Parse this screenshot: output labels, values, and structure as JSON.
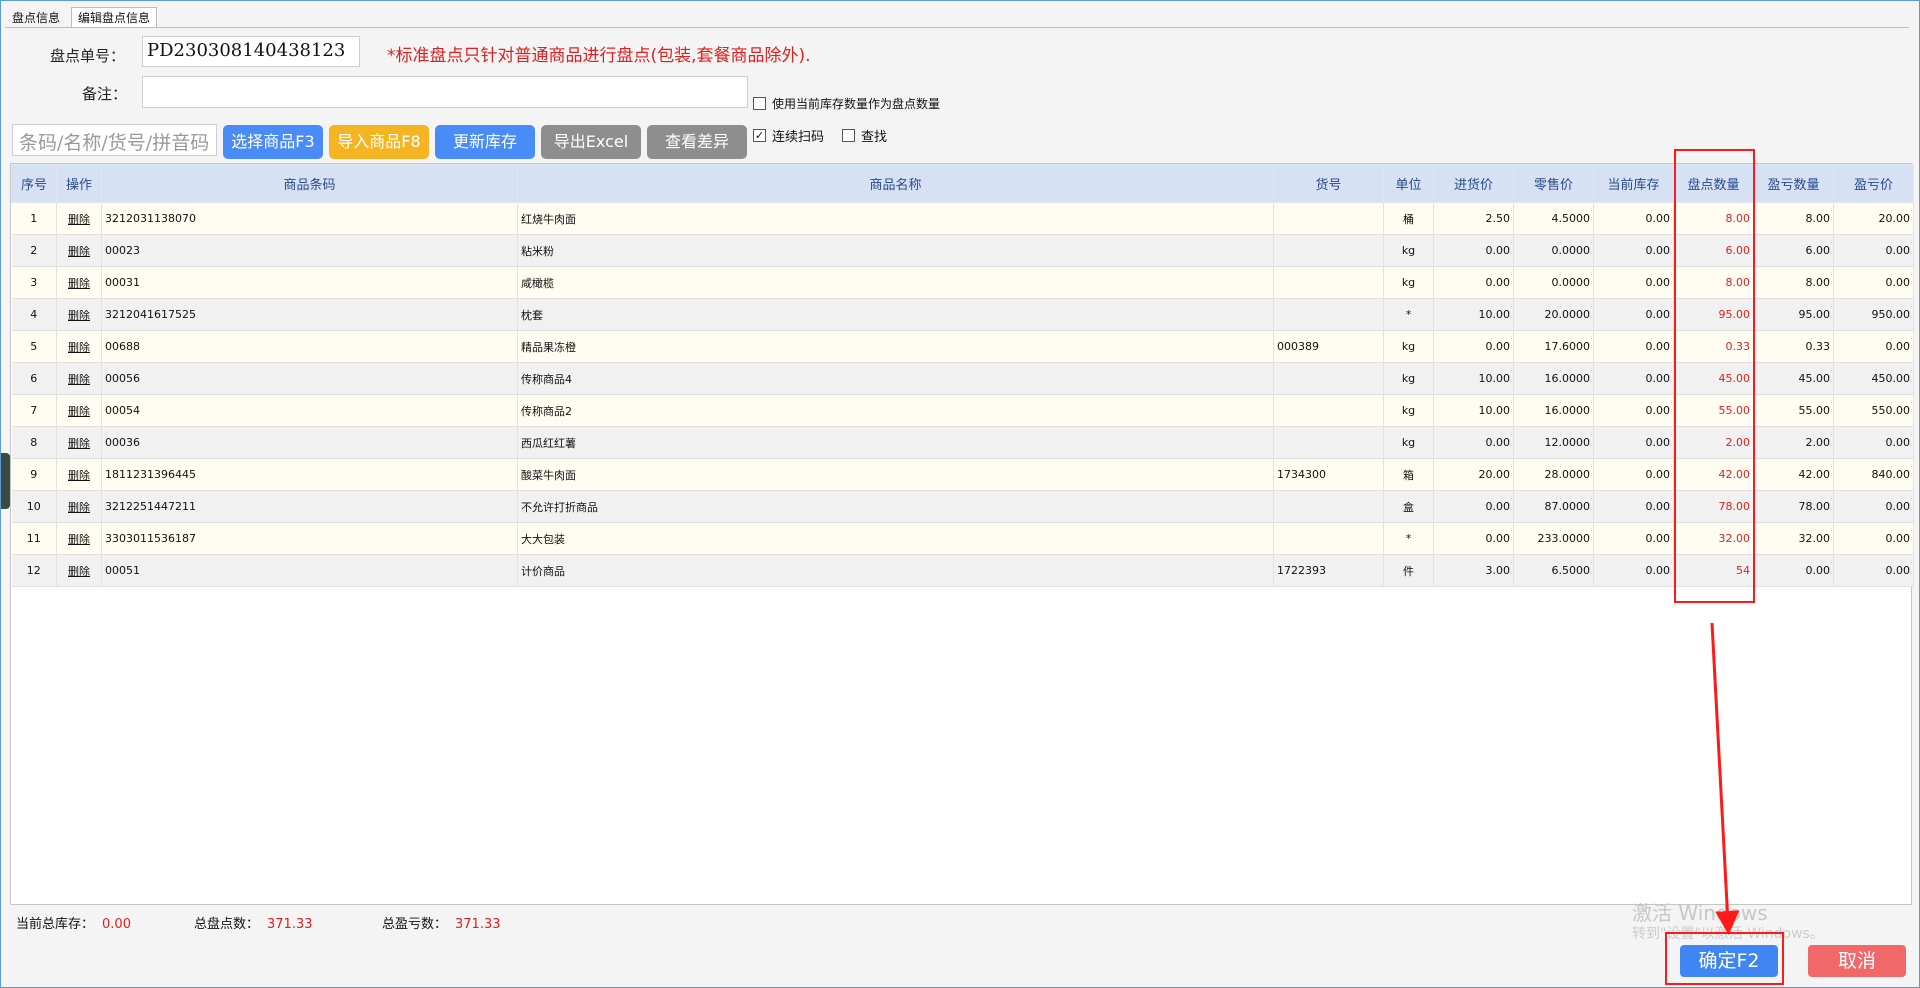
{
  "tabs": [
    "盘点信息",
    "编辑盘点信息"
  ],
  "form": {
    "order_label": "盘点单号：",
    "order_value": "PD230308140438123",
    "notice": "*标准盘点只针对普通商品进行盘点(包装,套餐商品除外).",
    "remark_label": "备注：",
    "remark_value": "",
    "use_stock_label": "使用当前库存数量作为盘点数量",
    "search_placeholder": "条码/名称/货号/拼音码",
    "continuous_scan_label": "连续扫码",
    "find_label": "查找"
  },
  "toolbar": {
    "select_goods": "选择商品F3",
    "import_goods": "导入商品F8",
    "update_stock": "更新库存",
    "export_excel": "导出Excel",
    "view_diff": "查看差异"
  },
  "columns": [
    "序号",
    "操作",
    "商品条码",
    "商品名称",
    "货号",
    "单位",
    "进货价",
    "零售价",
    "当前库存",
    "盘点数量",
    "盈亏数量",
    "盈亏价"
  ],
  "rows": [
    [
      "1",
      "删除",
      "3212031138070",
      "红烧牛肉面",
      "",
      "桶",
      "2.50",
      "4.5000",
      "0.00",
      "8.00",
      "8.00",
      "20.00"
    ],
    [
      "2",
      "删除",
      "00023",
      "粘米粉",
      "",
      "kg",
      "0.00",
      "0.0000",
      "0.00",
      "6.00",
      "6.00",
      "0.00"
    ],
    [
      "3",
      "删除",
      "00031",
      "咸橄榄",
      "",
      "kg",
      "0.00",
      "0.0000",
      "0.00",
      "8.00",
      "8.00",
      "0.00"
    ],
    [
      "4",
      "删除",
      "3212041617525",
      "枕套",
      "",
      "*",
      "10.00",
      "20.0000",
      "0.00",
      "95.00",
      "95.00",
      "950.00"
    ],
    [
      "5",
      "删除",
      "00688",
      "精品果冻橙",
      "000389",
      "kg",
      "0.00",
      "17.6000",
      "0.00",
      "0.33",
      "0.33",
      "0.00"
    ],
    [
      "6",
      "删除",
      "00056",
      "传称商品4",
      "",
      "kg",
      "10.00",
      "16.0000",
      "0.00",
      "45.00",
      "45.00",
      "450.00"
    ],
    [
      "7",
      "删除",
      "00054",
      "传称商品2",
      "",
      "kg",
      "10.00",
      "16.0000",
      "0.00",
      "55.00",
      "55.00",
      "550.00"
    ],
    [
      "8",
      "删除",
      "00036",
      "西瓜红红薯",
      "",
      "kg",
      "0.00",
      "12.0000",
      "0.00",
      "2.00",
      "2.00",
      "0.00"
    ],
    [
      "9",
      "删除",
      "1811231396445",
      "酸菜牛肉面",
      "1734300",
      "箱",
      "20.00",
      "28.0000",
      "0.00",
      "42.00",
      "42.00",
      "840.00"
    ],
    [
      "10",
      "删除",
      "3212251447211",
      "不允许打折商品",
      "",
      "盒",
      "0.00",
      "87.0000",
      "0.00",
      "78.00",
      "78.00",
      "0.00"
    ],
    [
      "11",
      "删除",
      "3303011536187",
      "大大包装",
      "",
      "*",
      "0.00",
      "233.0000",
      "0.00",
      "32.00",
      "32.00",
      "0.00"
    ],
    [
      "12",
      "删除",
      "00051",
      "计价商品",
      "1722393",
      "件",
      "3.00",
      "6.5000",
      "0.00",
      "54",
      "0.00",
      "0.00"
    ]
  ],
  "footer": {
    "total_stock_label": "当前总库存：",
    "total_stock_value": "0.00",
    "total_count_label": "总盘点数：",
    "total_count_value": "371.33",
    "total_profit_label": "总盈亏数：",
    "total_profit_value": "371.33"
  },
  "watermark": {
    "line1": "激活 Windows",
    "line2": "转到\"设置\"以激活 Windows。"
  },
  "actions": {
    "confirm": "确定F2",
    "cancel": "取消"
  },
  "colors": {
    "accent_blue": "#4a8cf7",
    "warning_red": "#e02020",
    "highlight_red": "#ff1a1a",
    "orange": "#f5b523"
  }
}
